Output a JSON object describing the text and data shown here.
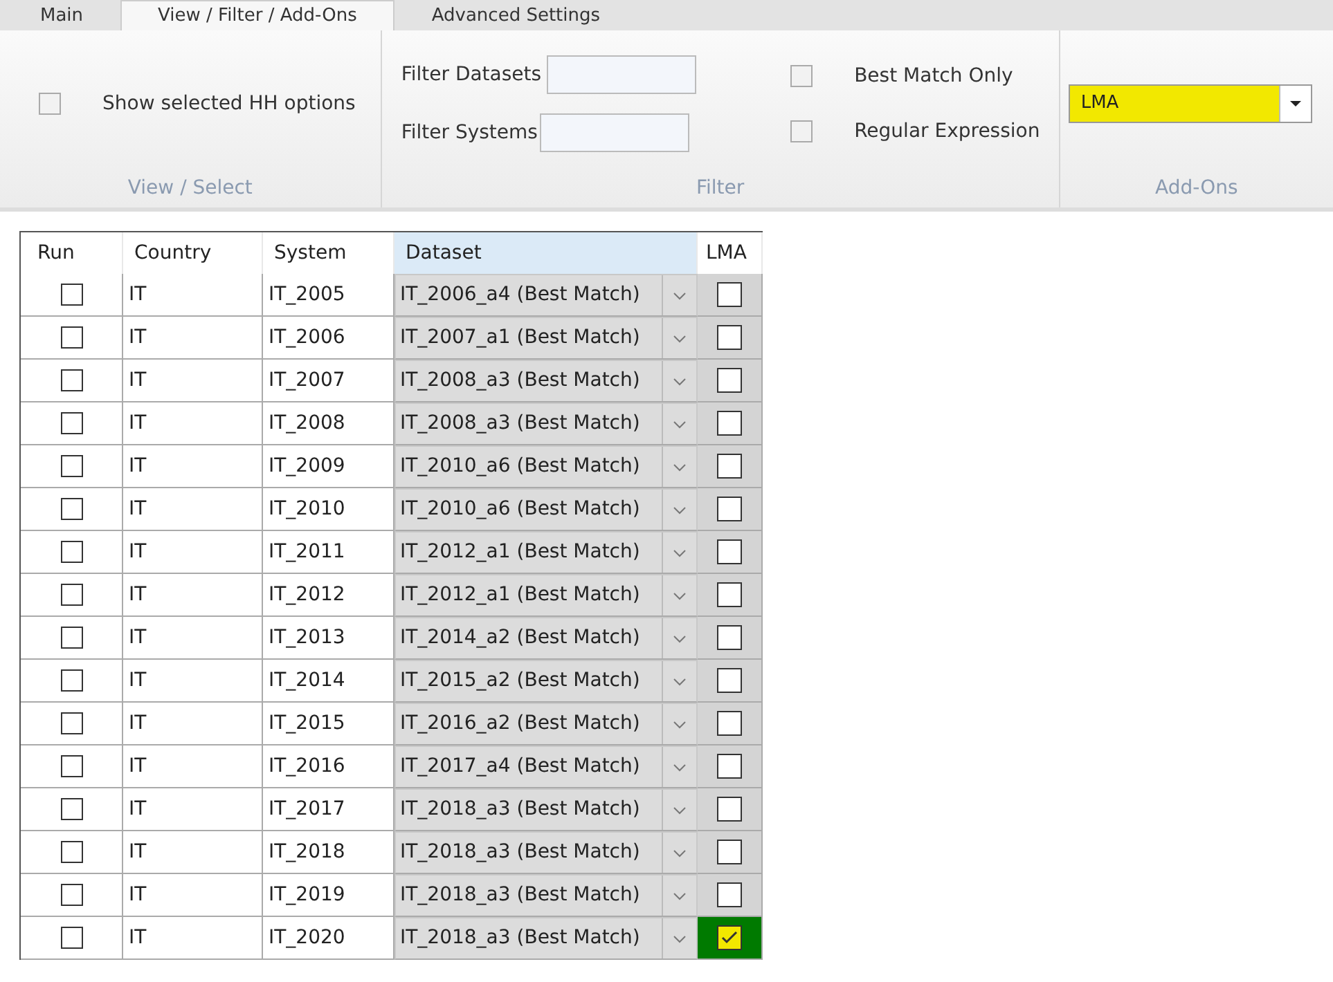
{
  "tabs": [
    {
      "label": "Main",
      "selected": false
    },
    {
      "label": "View / Filter / Add-Ons",
      "selected": true
    },
    {
      "label": "Advanced Settings",
      "selected": false
    }
  ],
  "ribbon": {
    "view_select": {
      "caption": "View / Select",
      "show_hh": {
        "label": "Show selected HH options",
        "checked": false
      }
    },
    "filter": {
      "caption": "Filter",
      "fields": [
        {
          "label": "Filter Datasets"
        },
        {
          "label": "Filter Systems"
        }
      ],
      "options": [
        {
          "label": "Best Match Only",
          "checked": false
        },
        {
          "label": "Regular Expression",
          "checked": false
        }
      ]
    },
    "add_ons": {
      "caption": "Add-Ons",
      "value": "LMA",
      "highlighted": true
    }
  },
  "table": {
    "columns": [
      "Run",
      "Country",
      "System",
      "Dataset",
      "LMA"
    ],
    "rows": [
      {
        "run": false,
        "country": "IT",
        "system": "IT_2005",
        "dataset": "IT_2006_a4 (Best Match)",
        "lma": false
      },
      {
        "run": false,
        "country": "IT",
        "system": "IT_2006",
        "dataset": "IT_2007_a1 (Best Match)",
        "lma": false
      },
      {
        "run": false,
        "country": "IT",
        "system": "IT_2007",
        "dataset": "IT_2008_a3 (Best Match)",
        "lma": false
      },
      {
        "run": false,
        "country": "IT",
        "system": "IT_2008",
        "dataset": "IT_2008_a3 (Best Match)",
        "lma": false
      },
      {
        "run": false,
        "country": "IT",
        "system": "IT_2009",
        "dataset": "IT_2010_a6 (Best Match)",
        "lma": false
      },
      {
        "run": false,
        "country": "IT",
        "system": "IT_2010",
        "dataset": "IT_2010_a6 (Best Match)",
        "lma": false
      },
      {
        "run": false,
        "country": "IT",
        "system": "IT_2011",
        "dataset": "IT_2012_a1 (Best Match)",
        "lma": false
      },
      {
        "run": false,
        "country": "IT",
        "system": "IT_2012",
        "dataset": "IT_2012_a1 (Best Match)",
        "lma": false
      },
      {
        "run": false,
        "country": "IT",
        "system": "IT_2013",
        "dataset": "IT_2014_a2 (Best Match)",
        "lma": false
      },
      {
        "run": false,
        "country": "IT",
        "system": "IT_2014",
        "dataset": "IT_2015_a2 (Best Match)",
        "lma": false
      },
      {
        "run": false,
        "country": "IT",
        "system": "IT_2015",
        "dataset": "IT_2016_a2 (Best Match)",
        "lma": false
      },
      {
        "run": false,
        "country": "IT",
        "system": "IT_2016",
        "dataset": "IT_2017_a4 (Best Match)",
        "lma": false
      },
      {
        "run": false,
        "country": "IT",
        "system": "IT_2017",
        "dataset": "IT_2018_a3 (Best Match)",
        "lma": false
      },
      {
        "run": false,
        "country": "IT",
        "system": "IT_2018",
        "dataset": "IT_2018_a3 (Best Match)",
        "lma": false
      },
      {
        "run": false,
        "country": "IT",
        "system": "IT_2019",
        "dataset": "IT_2018_a3 (Best Match)",
        "lma": false
      },
      {
        "run": false,
        "country": "IT",
        "system": "IT_2020",
        "dataset": "IT_2018_a3 (Best Match)",
        "lma": true
      }
    ]
  }
}
